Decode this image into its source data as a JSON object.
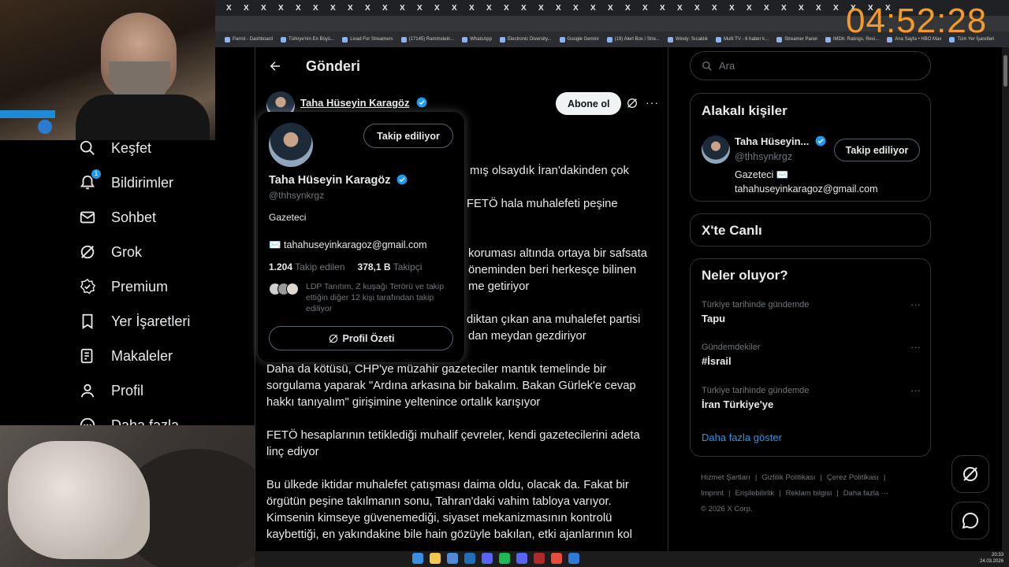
{
  "browser": {
    "tab_glyph": "X",
    "bookmarks": [
      "Parrot - Dashboard",
      "Türkiye'nin En Büyü...",
      "Livad For Streamers",
      "(17145) Rammstein...",
      "WhatsApp",
      "Electronic Diversity...",
      "Google Gemini",
      "(19) Alert Box / Stre...",
      "Windy: Sıcaklık",
      "Multi TV - 6 haber k...",
      "Streamer Panel",
      "IMDb: Ratings, Revi...",
      "Ana Sayfa • HBO Max",
      "Tüm Yer İşaretleri"
    ]
  },
  "overlay": {
    "clock": "04:52:28"
  },
  "nav": {
    "items": [
      {
        "label": "Keşfet",
        "icon": "search-icon"
      },
      {
        "label": "Bildirimler",
        "icon": "bell-icon",
        "badge": "1"
      },
      {
        "label": "Sohbet",
        "icon": "mail-icon"
      },
      {
        "label": "Grok",
        "icon": "grok-icon"
      },
      {
        "label": "Premium",
        "icon": "premium-icon"
      },
      {
        "label": "Yer İşaretleri",
        "icon": "bookmark-icon"
      },
      {
        "label": "Makaleler",
        "icon": "article-icon"
      },
      {
        "label": "Profil",
        "icon": "person-icon"
      },
      {
        "label": "Daha fazla",
        "icon": "more-circle-icon"
      }
    ]
  },
  "main": {
    "title": "Gönderi",
    "author_name": "Taha Hüseyin Karagöz",
    "author_handle_partial": "@thhsynkrgz",
    "subscribe_label": "Abone ol",
    "post_fragments": [
      "mış olsaydık İran'dakinden çok",
      "FETÖ hala muhalefeti peşine",
      "koruması altında ortaya bir safsata",
      "öneminden beri herkesçe bilinen",
      "me getiriyor",
      "diktan çıkan ana muhalefet partisi",
      "dan meydan gezdiriyor"
    ],
    "paragraphs": [
      "Daha da kötüsü, CHP'ye müzahir gazeteciler mantık temelinde bir sorgulama yaparak \"Ardına arkasına bir bakalım. Bakan Gürlek'e cevap hakkı tanıyalım\" girişimine yeltenince ortalık karışıyor",
      "FETÖ hesaplarının tetiklediği muhalif çevreler, kendi gazetecilerini adeta linç ediyor",
      "Bu ülkede iktidar muhalefet çatışması daima oldu, olacak da. Fakat bir örgütün peşine takılmanın sonu, Tahran'daki vahim tabloya varıyor. Kimsenin kimseye güvenemediği, siyaset mekanizmasının kontrolü kaybettiği, en yakındakine bile hain gözüyle bakılan, etki ajanlarının kol"
    ]
  },
  "hovercard": {
    "follow_label": "Takip ediliyor",
    "name": "Taha Hüseyin Karagöz",
    "handle": "@thhsynkrgz",
    "bio": "Gazeteci",
    "email": "✉️ tahahuseyinkaragoz@gmail.com",
    "following_count": "1.204",
    "following_label": "Takip edilen",
    "followers_count": "378,1 B",
    "followers_label": "Takipçi",
    "followed_by": "LDP Tanıtım, Z kuşağı Terörü ve takip ettiğin diğer 12 kişi tarafından takip ediliyor",
    "profile_summary_label": "Profil Özeti"
  },
  "sidebar": {
    "search_placeholder": "Ara",
    "related_title": "Alakalı kişiler",
    "related_name": "Taha Hüseyin...",
    "related_handle": "@thhsynkrgz",
    "related_follow_label": "Takip ediliyor",
    "related_bio_line1": "Gazeteci ✉️",
    "related_bio_line2": "tahahuseyinkaragoz@gmail.com",
    "live_title": "X'te Canlı",
    "trends_title": "Neler oluyor?",
    "trends": [
      {
        "context": "Türkiye tarihinde gündemde",
        "name": "Tapu"
      },
      {
        "context": "Gündemdekiler",
        "name": "#İsrail"
      },
      {
        "context": "Türkiye tarihinde gündemde",
        "name": "İran Türkiye'ye"
      }
    ],
    "trend_more": "···",
    "show_more": "Daha fazla göster",
    "footer": [
      "Hizmet Şartları",
      "|",
      "Gizlilik Politikası",
      "|",
      "Çerez Politikası",
      "|",
      "Imprint",
      "|",
      "Erişilebilirlik",
      "|",
      "Reklam bilgisi",
      "|",
      "Daha fazla ···",
      "© 2026 X Corp."
    ]
  },
  "taskbar": {
    "time": "20:33",
    "date": "24.03.2026"
  },
  "colors": {
    "accent": "#1d9bf0",
    "clock": "#f39a2a",
    "border": "#2f3336",
    "muted": "#71767b"
  }
}
